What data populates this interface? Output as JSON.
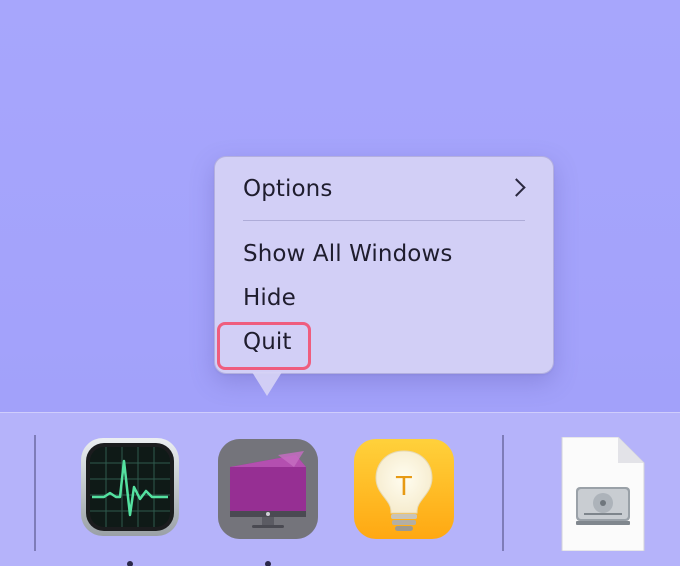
{
  "context_menu": {
    "items": [
      {
        "label": "Options",
        "has_submenu": true
      },
      {
        "label": "Show All Windows"
      },
      {
        "label": "Hide"
      },
      {
        "label": "Quit",
        "highlighted": true
      }
    ]
  },
  "dock": {
    "apps": [
      {
        "icon": "activity-monitor-icon",
        "running": true
      },
      {
        "icon": "purple-display-app-icon",
        "running": true
      },
      {
        "icon": "tips-lightbulb-icon",
        "running": false
      },
      {
        "icon": "disk-image-file-icon",
        "running": false
      }
    ]
  },
  "colors": {
    "desktop_background": "#a5a4fb",
    "menu_background": "#d6d2f5",
    "quit_highlight": "#ef5d7e",
    "tips_yellow": "#ffc928",
    "activity_monitor_line": "#54e1a0",
    "purple_app": "#8f2d8c"
  }
}
